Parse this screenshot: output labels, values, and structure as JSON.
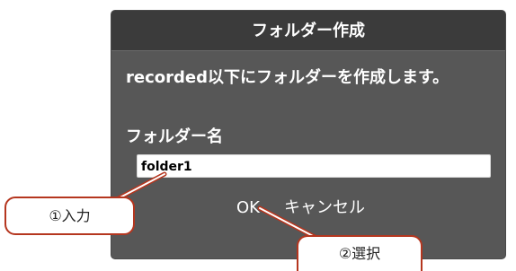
{
  "dialog": {
    "title": "フォルダー作成",
    "message": "recorded以下にフォルダーを作成します。",
    "folder_label": "フォルダー名",
    "folder_name_value": "folder1",
    "ok_label": "OK",
    "cancel_label": "キャンセル"
  },
  "annotations": {
    "step1": "①入力",
    "step2": "②選択"
  },
  "colors": {
    "dialog_body": "#575757",
    "dialog_header": "#3b3b3b",
    "callout_border": "#b5361f",
    "callout_fill": "#ffffff"
  }
}
